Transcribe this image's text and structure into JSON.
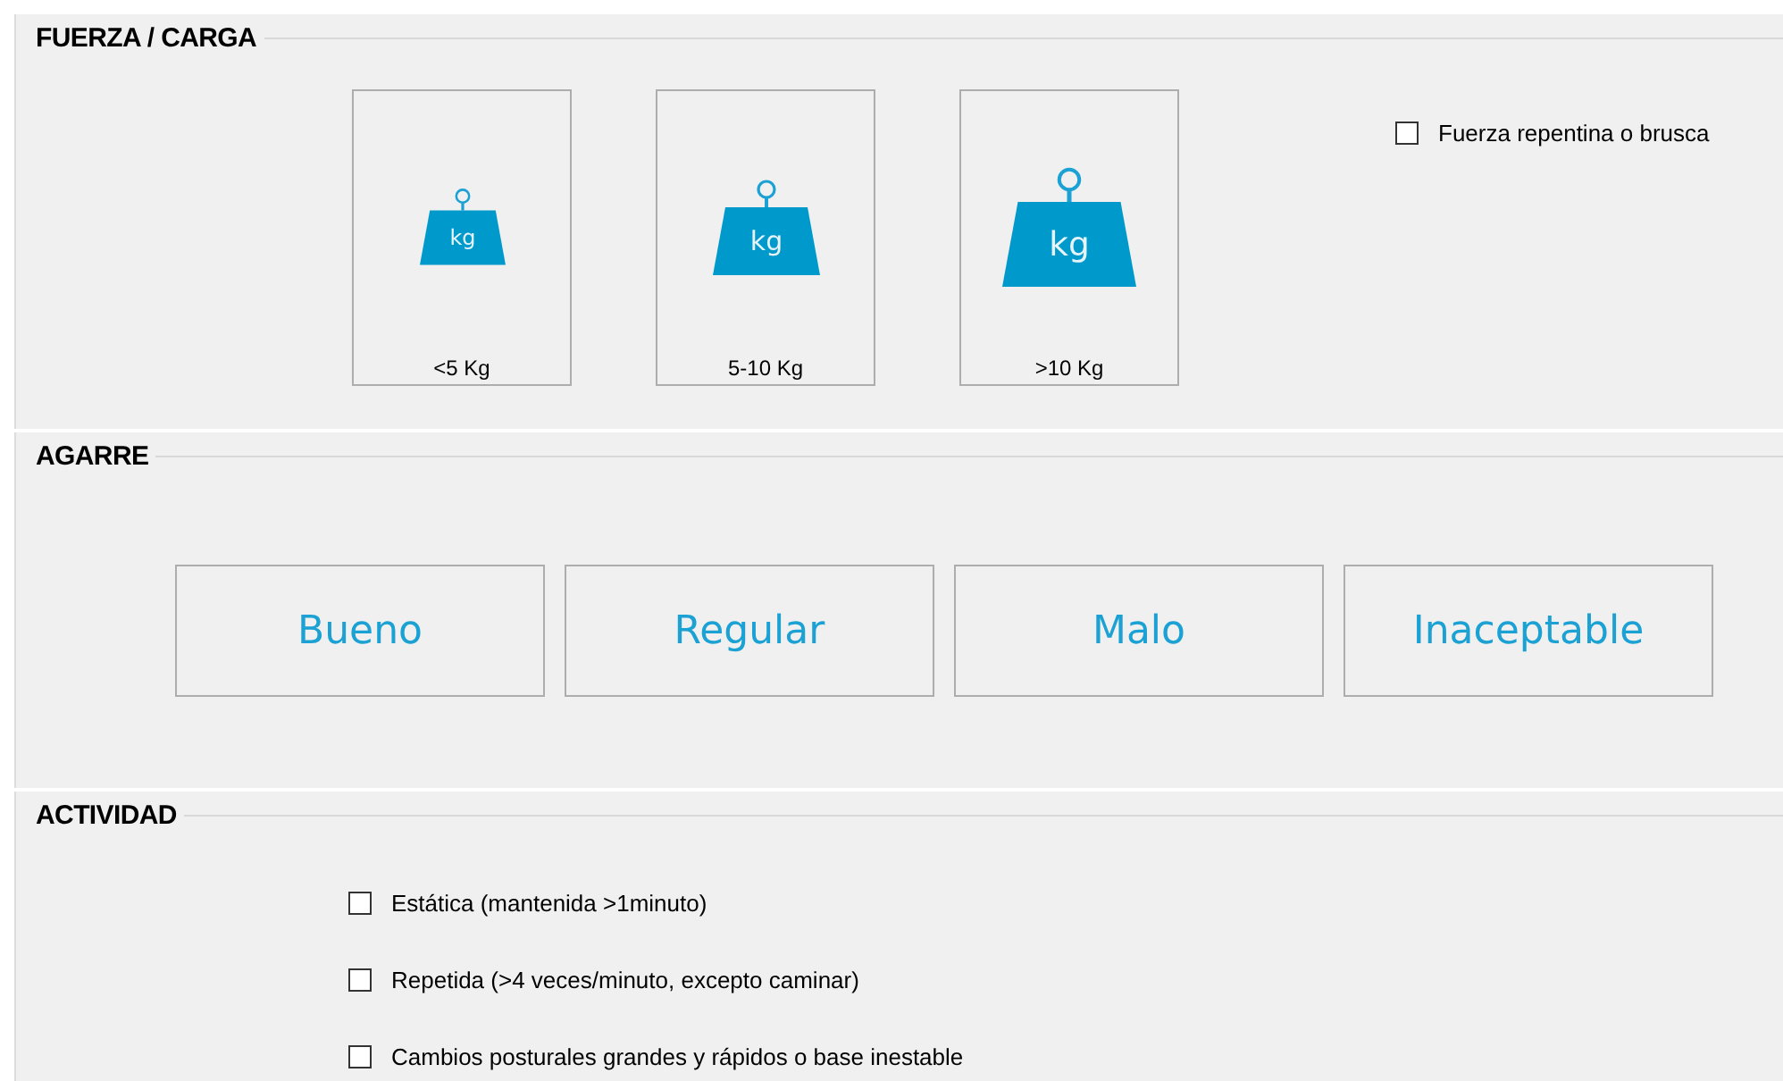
{
  "sections": [
    {
      "kind": "weights",
      "title": "FUERZA / CARGA",
      "options": [
        {
          "kind": "small",
          "icon_text": "kg",
          "label": "<5 Kg",
          "selected": false
        },
        {
          "kind": "medium",
          "icon_text": "kg",
          "label": "5-10 Kg",
          "selected": false
        },
        {
          "kind": "large",
          "icon_text": "kg",
          "label": ">10 Kg",
          "selected": false
        }
      ],
      "checkbox": {
        "label": "Fuerza repentina o brusca",
        "checked": false
      }
    },
    {
      "kind": "buttons",
      "title": "AGARRE",
      "buttons": [
        {
          "label": "Bueno",
          "selected": false
        },
        {
          "label": "Regular",
          "selected": false
        },
        {
          "label": "Malo",
          "selected": false
        },
        {
          "label": "Inaceptable",
          "selected": false
        }
      ]
    },
    {
      "kind": "checklist",
      "title": "ACTIVIDAD",
      "items": [
        {
          "label": "Estática (mantenida >1minuto)",
          "checked": false
        },
        {
          "label": "Repetida (>4 veces/minuto, excepto caminar)",
          "checked": false
        },
        {
          "label": "Cambios posturales grandes y rápidos o base inestable",
          "checked": false
        }
      ]
    }
  ]
}
